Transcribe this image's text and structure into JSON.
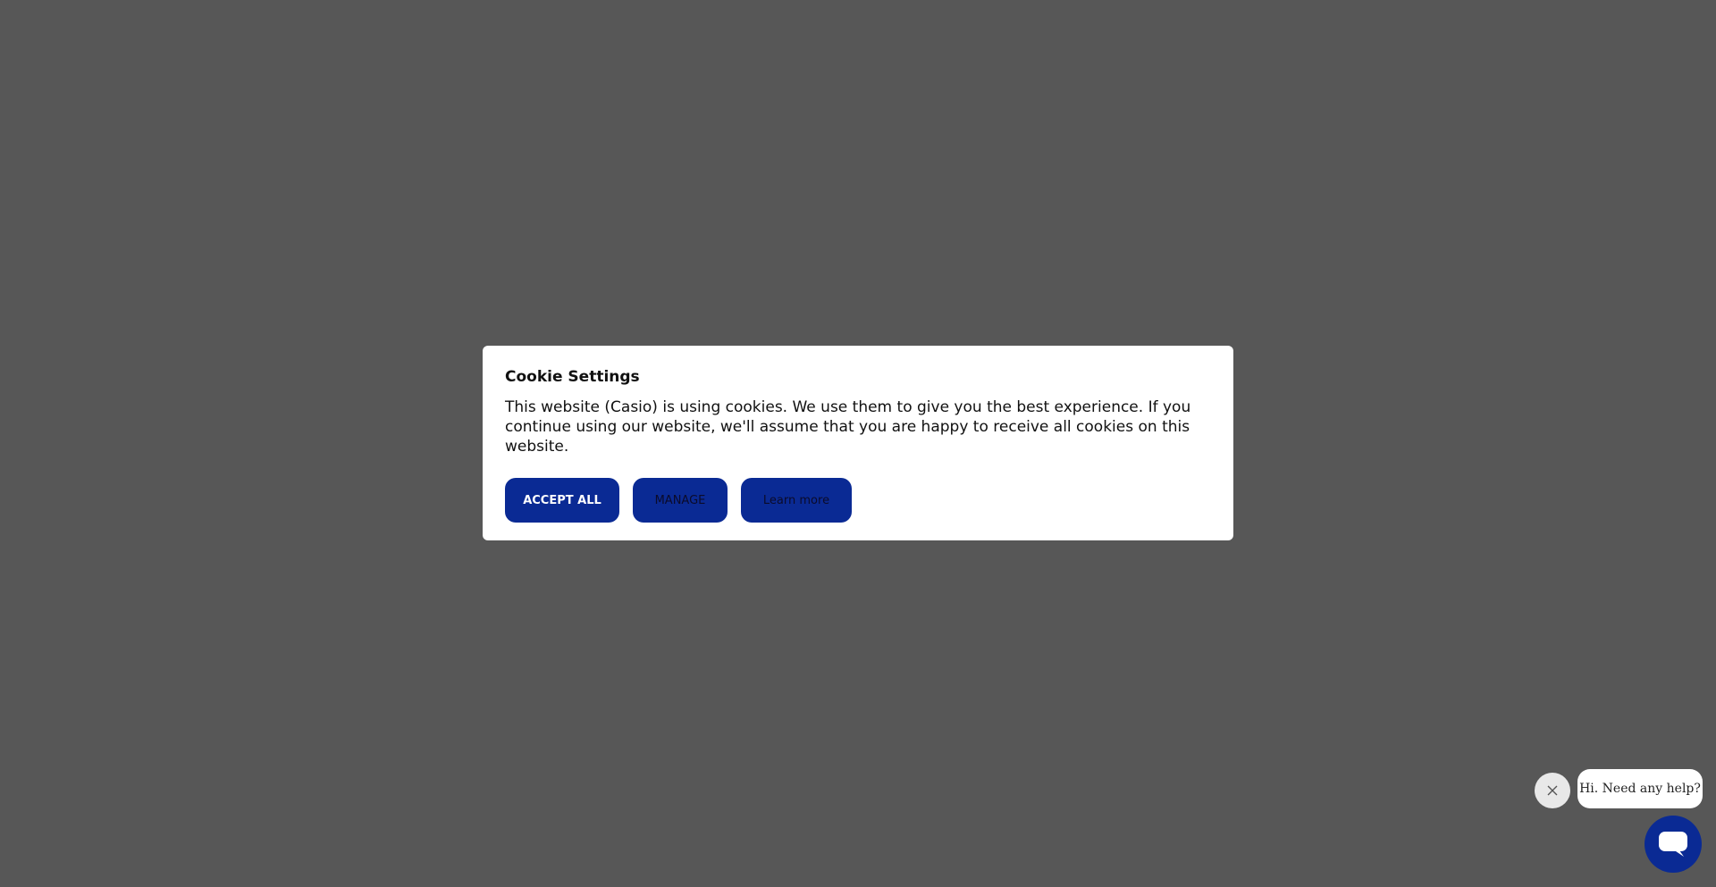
{
  "cookie_modal": {
    "title": "Cookie Settings",
    "body": "This website (Casio) is using cookies. We use them to give you the best experience. If you continue using our website, we'll assume that you are happy to receive all cookies on this website.",
    "buttons": {
      "accept_all": "ACCEPT ALL",
      "manage": "MANAGE",
      "learn_more": "Learn more"
    }
  },
  "chat_widget": {
    "greeting": "Hi. Need any help?",
    "close_icon": "close-icon",
    "launcher_icon": "chat-icon"
  },
  "colors": {
    "overlay": "#575757",
    "brand_blue": "#0a2a94",
    "modal_bg": "#ffffff"
  }
}
